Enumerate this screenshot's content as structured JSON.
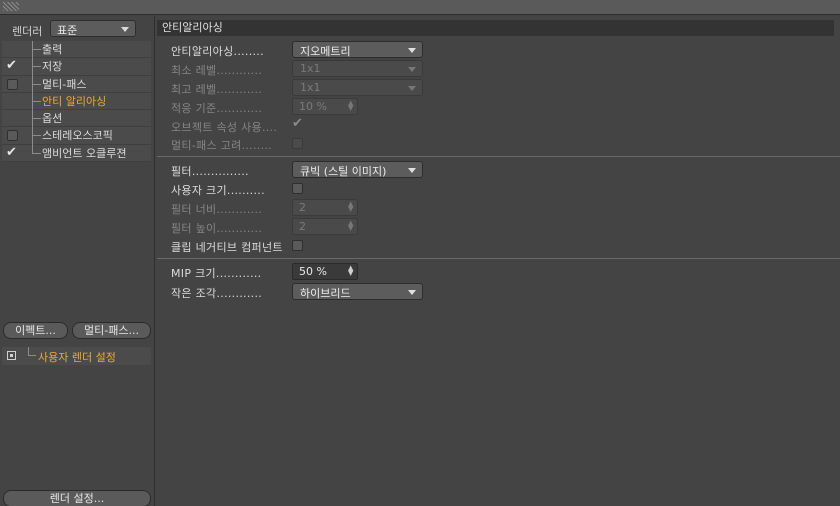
{
  "left": {
    "renderer_label": "렌더러",
    "renderer_value": "표준",
    "items": [
      {
        "label": "출력",
        "checkbox": "none",
        "active": false
      },
      {
        "label": "저장",
        "checkbox": "checked",
        "active": false
      },
      {
        "label": "멀티-패스",
        "checkbox": "unchecked",
        "active": false
      },
      {
        "label": "안티 알리아싱",
        "checkbox": "none",
        "active": true
      },
      {
        "label": "옵션",
        "checkbox": "none",
        "active": false
      },
      {
        "label": "스테레오스코픽",
        "checkbox": "unchecked",
        "active": false
      },
      {
        "label": "앰비언트 오클루젼",
        "checkbox": "checked",
        "active": false
      }
    ],
    "effect_button": "이펙트...",
    "multipass_button": "멀티-패스...",
    "user_settings": "사용자 렌더 설정",
    "render_settings_button": "렌더 설정..."
  },
  "right": {
    "section_title": "안티알리아싱",
    "group1": {
      "antialiasing": {
        "label": "안티알리아싱",
        "dots": "........",
        "value": "지오메트리"
      },
      "min_level": {
        "label": "최소 레벨",
        "dots": "............",
        "value": "1x1"
      },
      "max_level": {
        "label": "최고 레벨",
        "dots": "............",
        "value": "1x1"
      },
      "threshold": {
        "label": "적응 기준",
        "dots": "............",
        "value": "10 %"
      },
      "use_object": {
        "label": "오브젝트 속성 사용",
        "dots": "....",
        "check": "✔"
      },
      "consider_mp": {
        "label": "멀티-패스 고려",
        "dots": "........"
      }
    },
    "group2": {
      "filter": {
        "label": "필터",
        "dots": "...............",
        "value": "큐빅 (스틸 이미지)"
      },
      "custom_size": {
        "label": "사용자 크기",
        "dots": ".........."
      },
      "filter_width": {
        "label": "필터 너비",
        "dots": "............",
        "value": "2"
      },
      "filter_height": {
        "label": "필터 높이",
        "dots": "............",
        "value": "2"
      },
      "clip_negative": {
        "label": "클립 네거티브 컴퍼넌트"
      }
    },
    "group3": {
      "mip": {
        "label": "MIP 크기",
        "dots": "............",
        "value": "50 %"
      },
      "micropoly": {
        "label": "작은 조각",
        "dots": "............",
        "value": "하이브리드"
      }
    }
  },
  "colors": {
    "panel": "#444444",
    "accent": "#f0a832",
    "title_bar": "#333333"
  }
}
